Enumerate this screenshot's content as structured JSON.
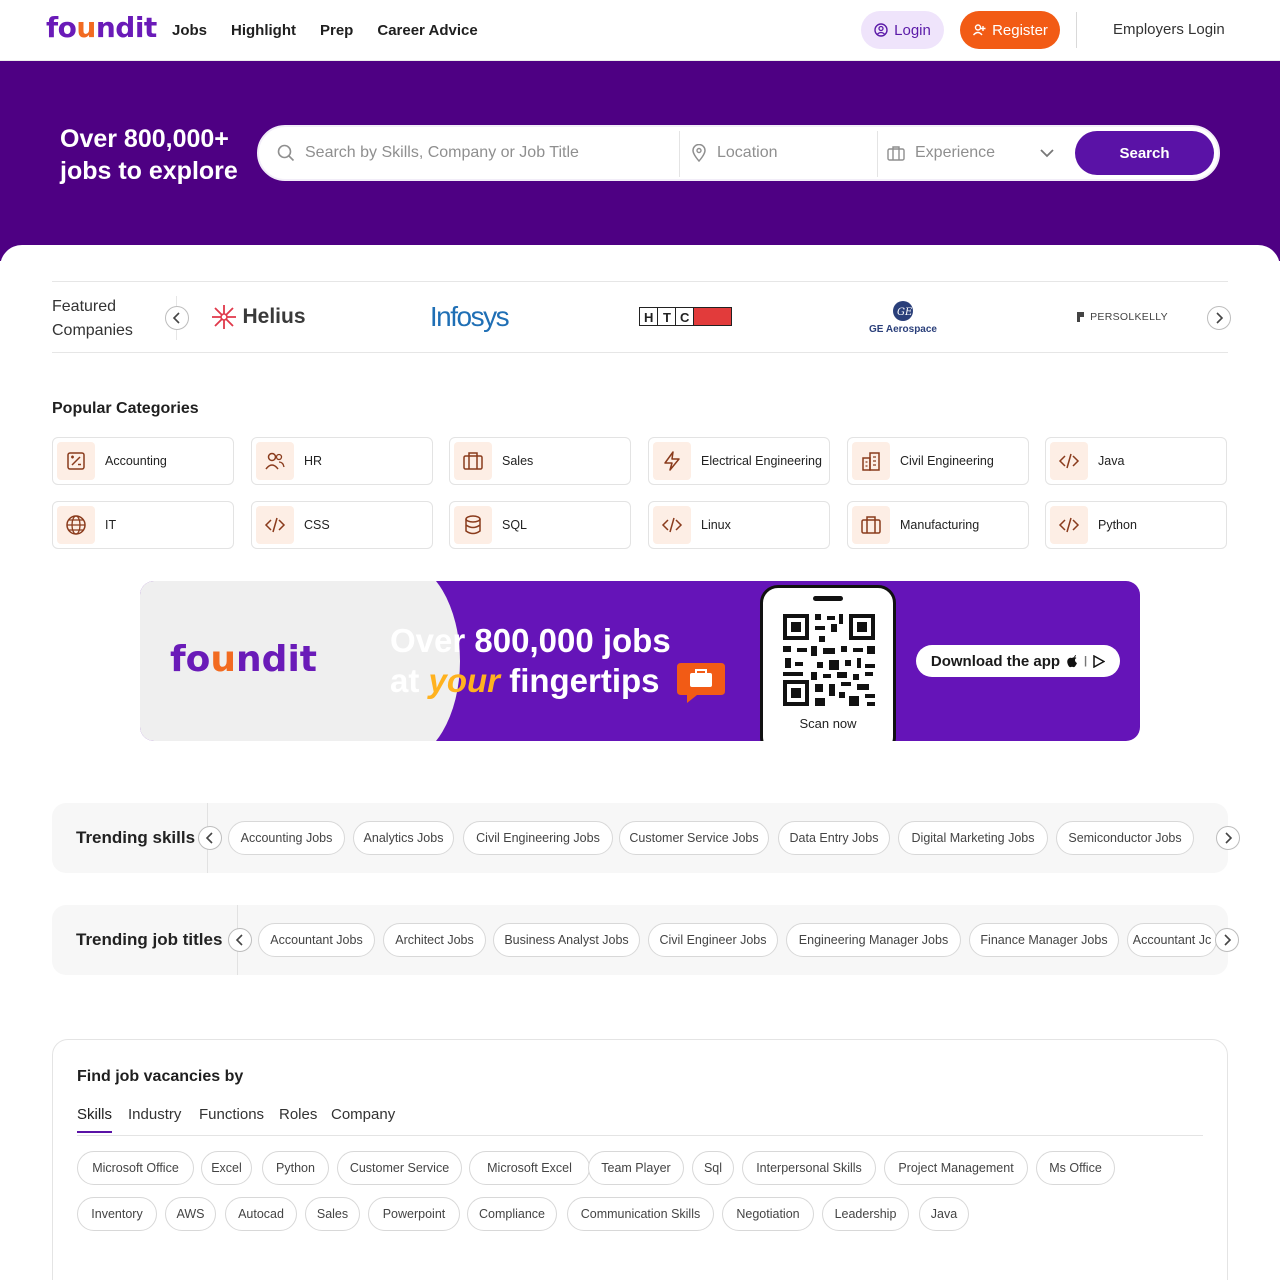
{
  "header": {
    "logo": "foundit",
    "nav": [
      "Jobs",
      "Highlight",
      "Prep",
      "Career Advice"
    ],
    "login_label": "Login",
    "register_label": "Register",
    "employers_label": "Employers Login"
  },
  "hero": {
    "title": "Over 800,000+ jobs to explore",
    "search_placeholder": "Search by Skills, Company or Job Title",
    "location_placeholder": "Location",
    "experience_placeholder": "Experience",
    "search_label": "Search"
  },
  "featured": {
    "label": "Featured Companies",
    "companies": [
      "Helius",
      "Infosys",
      "HTC",
      "GE Aerospace",
      "PERSOLKELLY"
    ]
  },
  "categories": {
    "title": "Popular Categories",
    "items": [
      {
        "label": "Accounting",
        "icon": "accounting-icon"
      },
      {
        "label": "HR",
        "icon": "people-icon"
      },
      {
        "label": "Sales",
        "icon": "briefcase-icon"
      },
      {
        "label": "Electrical Engineering",
        "icon": "lightning-icon"
      },
      {
        "label": "Civil Engineering",
        "icon": "building-icon"
      },
      {
        "label": "Java",
        "icon": "code-icon"
      },
      {
        "label": "IT",
        "icon": "globe-icon"
      },
      {
        "label": "CSS",
        "icon": "code-icon"
      },
      {
        "label": "SQL",
        "icon": "database-icon"
      },
      {
        "label": "Linux",
        "icon": "code-icon"
      },
      {
        "label": "Manufacturing",
        "icon": "briefcase-icon"
      },
      {
        "label": "Python",
        "icon": "code-icon"
      }
    ]
  },
  "banner": {
    "logo": "foundit",
    "line1": "Over 800,000 jobs",
    "line2_pre": "at ",
    "line2_em": "your",
    "line2_post": " fingertips",
    "scan_label": "Scan now",
    "download_label": "Download the app"
  },
  "trending_skills": {
    "title": "Trending skills",
    "chips": [
      "Accounting Jobs",
      "Analytics Jobs",
      "Civil Engineering Jobs",
      "Customer Service Jobs",
      "Data Entry Jobs",
      "Digital Marketing Jobs",
      "Semiconductor Jobs"
    ]
  },
  "trending_titles": {
    "title": "Trending job titles",
    "chips": [
      "Accountant Jobs",
      "Architect Jobs",
      "Business Analyst Jobs",
      "Civil Engineer Jobs",
      "Engineering Manager Jobs",
      "Finance Manager Jobs",
      "Accountant Jc"
    ]
  },
  "vacancies": {
    "title": "Find job vacancies by",
    "tabs": [
      "Skills",
      "Industry",
      "Functions",
      "Roles",
      "Company"
    ],
    "row1": [
      "Microsoft Office",
      "Excel",
      "Python",
      "Customer Service",
      "Microsoft Excel",
      "Team Player",
      "Sql",
      "Interpersonal Skills",
      "Project Management",
      "Ms Office"
    ],
    "row2": [
      "Inventory",
      "AWS",
      "Autocad",
      "Sales",
      "Powerpoint",
      "Compliance",
      "Communication Skills",
      "Negotiation",
      "Leadership",
      "Java"
    ]
  },
  "colors": {
    "brand_purple": "#4e0083",
    "button_purple": "#5a12a6",
    "register_orange": "#f25b15",
    "icon_bg": "#fdeee5",
    "icon_stroke": "#8a3b1c"
  }
}
